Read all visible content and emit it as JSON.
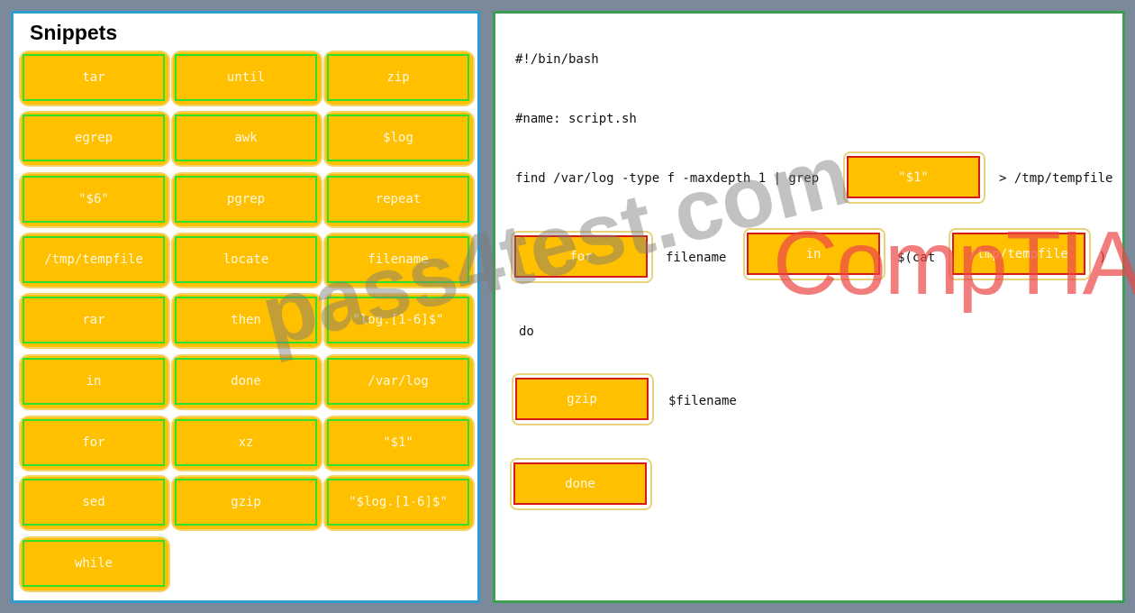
{
  "snippets": {
    "title": "Snippets",
    "items": [
      "tar",
      "until",
      "zip",
      "egrep",
      "awk",
      "$log",
      "\"$6\"",
      "pgrep",
      "repeat",
      "/tmp/tempfile",
      "locate",
      "filename",
      "rar",
      "then",
      "\"log.[1-6]$\"",
      "in",
      "done",
      "/var/log",
      "for",
      "xz",
      "\"$1\"",
      "sed",
      "gzip",
      "\"$log.[1-6]$\"",
      "while"
    ]
  },
  "script": {
    "line1": "#!/bin/bash",
    "line2": "#name: script.sh",
    "line3_prefix": "find /var/log -type f -maxdepth 1 | grep",
    "line3_suffix": "> /tmp/tempfile",
    "line4_mid1": "filename",
    "line4_mid2": "$(cat",
    "line4_end": ")",
    "line5": "do",
    "line6_suffix": "$filename",
    "drops": [
      "\"$1\"",
      "for",
      "in",
      "/tmp/tempfile",
      "gzip",
      "done"
    ]
  },
  "watermarks": [
    "pass4test.com",
    "CompTIA"
  ],
  "colors": {
    "chip": "#ffc000",
    "chip_border": "#2ee02e",
    "drop_border": "#d61a1a",
    "left_panel": "#2e9bd0",
    "right_panel": "#3aa050"
  }
}
